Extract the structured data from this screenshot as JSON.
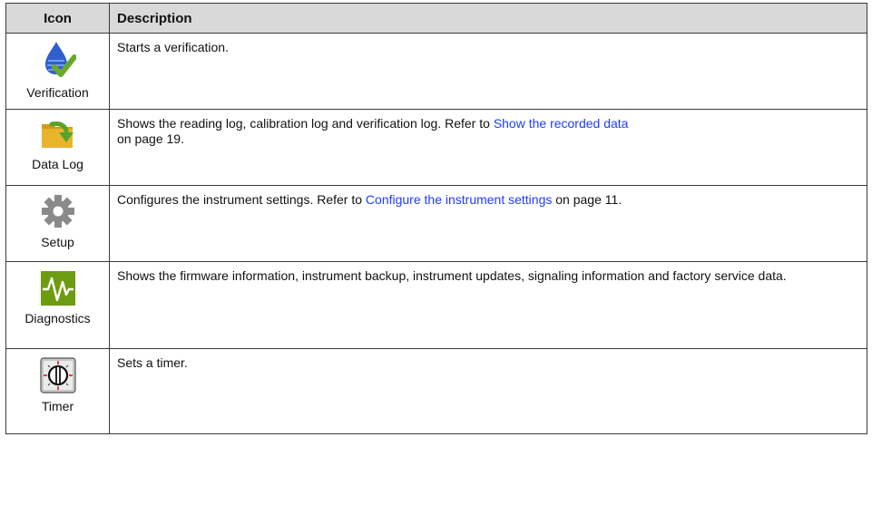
{
  "table": {
    "headers": {
      "icon": "Icon",
      "description": "Description"
    },
    "rows": [
      {
        "icon_name": "verification-icon",
        "label": "Verification",
        "desc_pre": "Starts a verification.",
        "link": "",
        "desc_post": ""
      },
      {
        "icon_name": "data-log-icon",
        "label": "Data Log",
        "desc_pre": "Shows the reading log, calibration log and verification log. Refer to ",
        "link": "Show the recorded data",
        "desc_post": " on page 19."
      },
      {
        "icon_name": "setup-gear-icon",
        "label": "Setup",
        "desc_pre": "Configures the instrument settings. Refer to ",
        "link": "Configure the instrument settings",
        "desc_post": " on page 11."
      },
      {
        "icon_name": "diagnostics-icon",
        "label": "Diagnostics",
        "desc_pre": "Shows the firmware information, instrument backup, instrument updates, signaling information and factory service data.",
        "link": "",
        "desc_post": ""
      },
      {
        "icon_name": "timer-icon",
        "label": "Timer",
        "desc_pre": "Sets a timer.",
        "link": "",
        "desc_post": ""
      }
    ]
  },
  "colors": {
    "header_bg": "#d9d9d9",
    "link": "#1f3cff",
    "drop_blue": "#2f5fcf",
    "check_green": "#6aa82c",
    "folder_yellow": "#e8b52a",
    "arrow_green": "#5aa22a",
    "diag_green": "#6e9c10",
    "gear_gray": "#8a8a8a"
  }
}
